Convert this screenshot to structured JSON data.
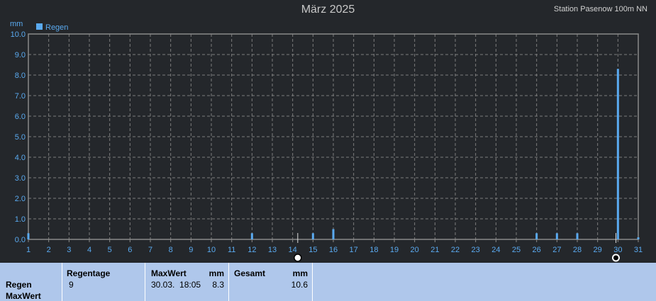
{
  "chart_data": {
    "type": "bar",
    "title": "März 2025",
    "station": "Station Pasenow 100m NN",
    "ylabel": "mm",
    "legend": {
      "label": "Regen",
      "position": "top-left",
      "color": "#5aaaf0"
    },
    "ylim": [
      0,
      10
    ],
    "yticks": [
      "0.0",
      "1.0",
      "2.0",
      "3.0",
      "4.0",
      "5.0",
      "6.0",
      "7.0",
      "8.0",
      "9.0",
      "10.0"
    ],
    "xlim": [
      1,
      31
    ],
    "xticks": [
      "1",
      "2",
      "3",
      "4",
      "5",
      "6",
      "7",
      "8",
      "9",
      "10",
      "11",
      "12",
      "13",
      "14",
      "15",
      "16",
      "17",
      "18",
      "19",
      "20",
      "21",
      "22",
      "23",
      "24",
      "25",
      "26",
      "27",
      "28",
      "29",
      "30",
      "31"
    ],
    "grid": true,
    "series": [
      {
        "name": "Regen",
        "points": [
          {
            "x": 1.0,
            "y": 0.3
          },
          {
            "x": 12.0,
            "y": 0.3
          },
          {
            "x": 15.0,
            "y": 0.3
          },
          {
            "x": 16.0,
            "y": 0.5
          },
          {
            "x": 26.0,
            "y": 0.3
          },
          {
            "x": 27.0,
            "y": 0.3
          },
          {
            "x": 28.0,
            "y": 0.3
          },
          {
            "x": 30.0,
            "y": 8.3
          },
          {
            "x": 31.0,
            "y": 0.1
          }
        ]
      }
    ],
    "markers": [
      {
        "x": 14.25,
        "icon": "full-moon-icon"
      },
      {
        "x": 29.9,
        "icon": "new-moon-icon"
      }
    ]
  },
  "stats": {
    "row_label": "Regen",
    "row_sublabel": "MaxWert",
    "regentage_label": "Regentage",
    "regentage_value": "9",
    "maxwert_label": "MaxWert",
    "maxwert_unit": "mm",
    "maxwert_date": "30.03.  18:05",
    "maxwert_value": "8.3",
    "gesamt_label": "Gesamt",
    "gesamt_unit": "mm",
    "gesamt_value": "10.6"
  }
}
